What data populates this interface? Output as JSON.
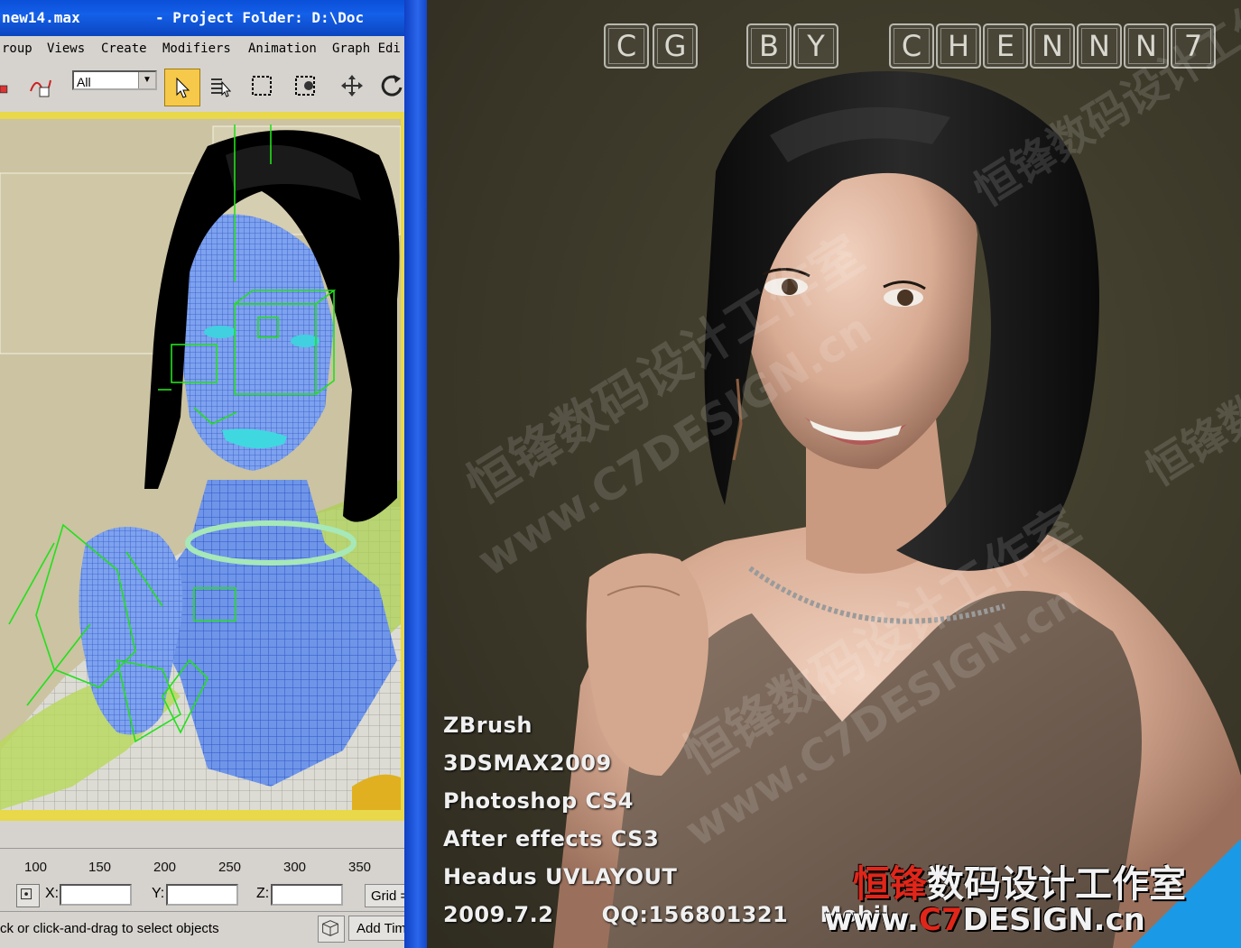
{
  "max": {
    "title_file": "new14.max",
    "title_project": "- Project Folder: D:\\Doc",
    "menu": [
      "roup",
      "Views",
      "Create",
      "Modifiers",
      "Animation",
      "Graph Edi"
    ],
    "selection_filter": "All",
    "timeline_ticks": [
      "100",
      "150",
      "200",
      "250",
      "300",
      "350"
    ],
    "coord_labels": {
      "x": "X:",
      "y": "Y:",
      "z": "Z:"
    },
    "grid_label": "Grid =",
    "status_text": "ck or click-and-drag to select objects",
    "add_time_label": "Add Tim"
  },
  "render": {
    "title_tiles": [
      "C",
      "G",
      "B",
      "Y",
      "C",
      "H",
      "E",
      "N",
      "N",
      "N",
      "7"
    ],
    "credits": [
      "ZBrush",
      "3DSMAX2009",
      "Photoshop CS4",
      "After effects CS3",
      "Headus UVLAYOUT",
      "2009.7.2      QQ:156801321    Mobil"
    ],
    "studio_cn_red": "恒锋",
    "studio_cn_rest": "数码设计工作室",
    "studio_url_pre": "www.",
    "studio_url_red": "C7",
    "studio_url_post": "DESIGN.cn",
    "watermark_cn": "恒锋数码设计工作室",
    "watermark_url": "www.C7DESIGN.cn"
  },
  "colors": {
    "max_title_blue": "#0a4fd8",
    "viewport_bg": "#cbc3a2",
    "wire_blue": "#4c7de8",
    "gizmo_green": "#22e01a",
    "render_bg": "#3c3829",
    "brand_red": "#e0261a"
  },
  "icons": [
    "select-object-icon",
    "select-by-name-icon",
    "region-select-icon",
    "window-crossing-icon",
    "move-icon",
    "rotate-icon",
    "absolute-mode-icon",
    "view-cube-icon"
  ]
}
